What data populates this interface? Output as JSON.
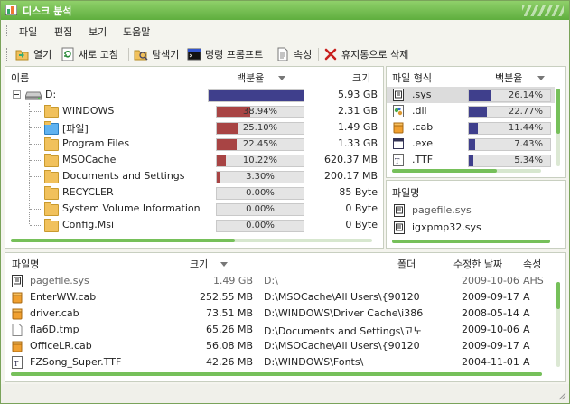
{
  "window": {
    "title": "디스크 분석"
  },
  "menu": [
    "파일",
    "편집",
    "보기",
    "도움말"
  ],
  "toolbar": {
    "open": "열기",
    "refresh": "새로 고침",
    "explorer": "탐색기",
    "cmd": "명령 프롬프트",
    "props": "속성",
    "delete": "휴지통으로 삭제"
  },
  "tree": {
    "col_name": "이름",
    "col_pct": "백분율",
    "col_size": "크기",
    "root": {
      "label": "D:",
      "pct": 100,
      "size": "5.93 GB"
    },
    "items": [
      {
        "label": "WINDOWS",
        "pct_text": "38.94%",
        "pct": 38.94,
        "size": "2.31 GB"
      },
      {
        "label": "[파일]",
        "pct_text": "25.10%",
        "pct": 25.1,
        "size": "1.49 GB"
      },
      {
        "label": "Program Files",
        "pct_text": "22.45%",
        "pct": 22.45,
        "size": "1.33 GB"
      },
      {
        "label": "MSOCache",
        "pct_text": "10.22%",
        "pct": 10.22,
        "size": "620.37 MB"
      },
      {
        "label": "Documents and Settings",
        "pct_text": "3.30%",
        "pct": 3.3,
        "size": "200.17 MB"
      },
      {
        "label": "RECYCLER",
        "pct_text": "0.00%",
        "pct": 0,
        "size": "85 Byte"
      },
      {
        "label": "System Volume Information",
        "pct_text": "0.00%",
        "pct": 0,
        "size": "0 Byte"
      },
      {
        "label": "Config.Msi",
        "pct_text": "0.00%",
        "pct": 0,
        "size": "0 Byte"
      }
    ],
    "hscroll_fraction": 0.62
  },
  "types": {
    "col_type": "파일 형식",
    "col_pct": "백분율",
    "items": [
      {
        "ext": ".sys",
        "pct_text": "26.14%",
        "pct": 26.14,
        "icon": "sys-file-icon"
      },
      {
        "ext": ".dll",
        "pct_text": "22.77%",
        "pct": 22.77,
        "icon": "dll-file-icon"
      },
      {
        "ext": ".cab",
        "pct_text": "11.44%",
        "pct": 11.44,
        "icon": "cab-file-icon"
      },
      {
        "ext": ".exe",
        "pct_text": "7.43%",
        "pct": 7.43,
        "icon": "exe-file-icon"
      },
      {
        "ext": ".TTF",
        "pct_text": "5.34%",
        "pct": 5.34,
        "icon": "font-file-icon"
      }
    ]
  },
  "filenames": {
    "col": "파일명",
    "items": [
      "pagefile.sys",
      "igxpmp32.sys"
    ]
  },
  "files": {
    "col_name": "파일명",
    "col_size": "크기",
    "col_folder": "폴더",
    "col_date": "수정한 날짜",
    "col_attr": "속성",
    "items": [
      {
        "name": "pagefile.sys",
        "size": "1.49 GB",
        "folder": "D:\\",
        "date": "2009-10-06",
        "attr": "AHS",
        "icon": "sys-file-icon",
        "muted": true
      },
      {
        "name": "EnterWW.cab",
        "size": "252.55 MB",
        "folder": "D:\\MSOCache\\All Users\\{90120",
        "date": "2009-09-17",
        "attr": "A",
        "icon": "cab-file-icon",
        "muted": false
      },
      {
        "name": "driver.cab",
        "size": "73.51 MB",
        "folder": "D:\\WINDOWS\\Driver Cache\\i386",
        "date": "2008-05-14",
        "attr": "A",
        "icon": "cab-file-icon",
        "muted": false
      },
      {
        "name": "fla6D.tmp",
        "size": "65.26 MB",
        "folder": "D:\\Documents and Settings\\고노",
        "date": "2009-10-06",
        "attr": "A",
        "icon": "blank-file-icon",
        "muted": false
      },
      {
        "name": "OfficeLR.cab",
        "size": "56.08 MB",
        "folder": "D:\\MSOCache\\All Users\\{90120",
        "date": "2009-09-17",
        "attr": "A",
        "icon": "cab-file-icon",
        "muted": false
      },
      {
        "name": "FZSong_Super.TTF",
        "size": "42.26 MB",
        "folder": "D:\\WINDOWS\\Fonts\\",
        "date": "2004-11-01",
        "attr": "A",
        "icon": "font-file-icon",
        "muted": false
      }
    ]
  },
  "colors": {
    "accent_green": "#6cbf4c",
    "bar_navy": "#3f3f8c",
    "bar_red": "#a84444",
    "selected_row": "#dcdcdc"
  }
}
